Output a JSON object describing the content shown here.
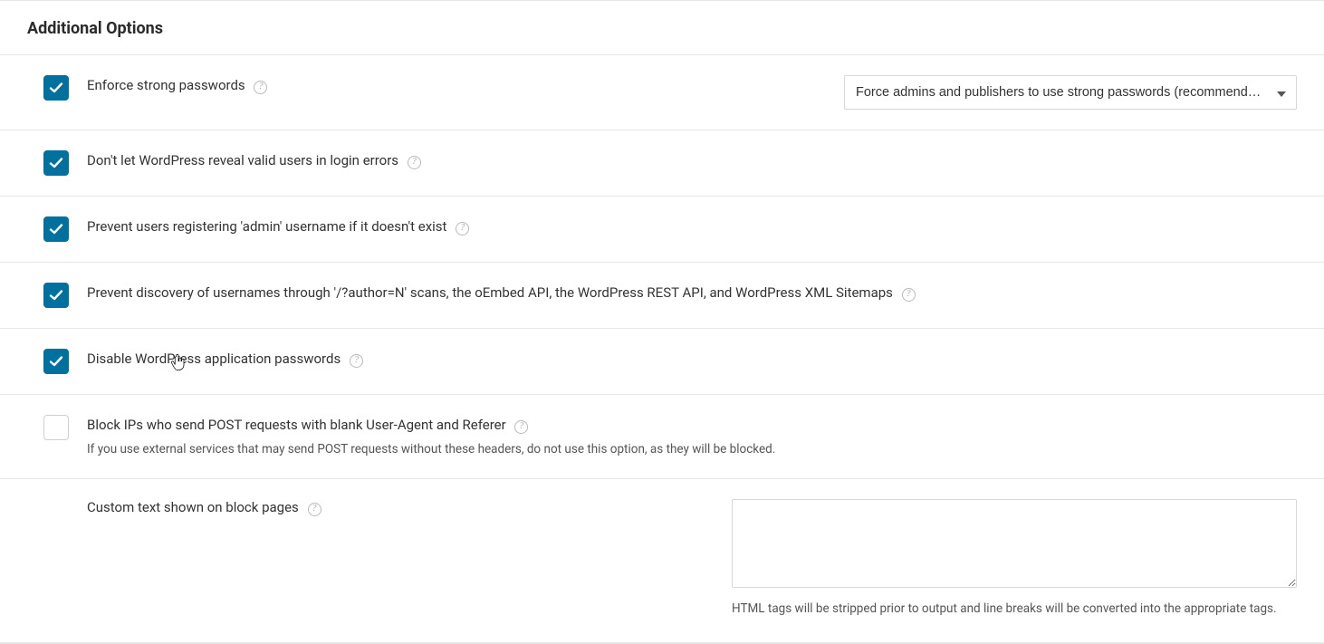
{
  "section": {
    "title": "Additional Options"
  },
  "options": [
    {
      "checked": true,
      "label": "Enforce strong passwords",
      "help": true,
      "sub": "",
      "select": {
        "value": "Force admins and publishers to use strong passwords (recommended)",
        "options": [
          "Force admins and publishers to use strong passwords (recommended)"
        ]
      }
    },
    {
      "checked": true,
      "label": "Don't let WordPress reveal valid users in login errors",
      "help": true,
      "sub": ""
    },
    {
      "checked": true,
      "label": "Prevent users registering 'admin' username if it doesn't exist",
      "help": true,
      "sub": ""
    },
    {
      "checked": true,
      "label": "Prevent discovery of usernames through '/?author=N' scans, the oEmbed API, the WordPress REST API, and WordPress XML Sitemaps",
      "help": true,
      "sub": ""
    },
    {
      "checked": true,
      "label": "Disable WordPress application passwords",
      "help": true,
      "sub": ""
    },
    {
      "checked": false,
      "label": "Block IPs who send POST requests with blank User-Agent and Referer",
      "help": true,
      "sub": "If you use external services that may send POST requests without these headers, do not use this option, as they will be blocked."
    }
  ],
  "customText": {
    "label": "Custom text shown on block pages",
    "help": true,
    "value": "",
    "helpText": "HTML tags will be stripped prior to output and line breaks will be converted into the appropriate tags."
  }
}
